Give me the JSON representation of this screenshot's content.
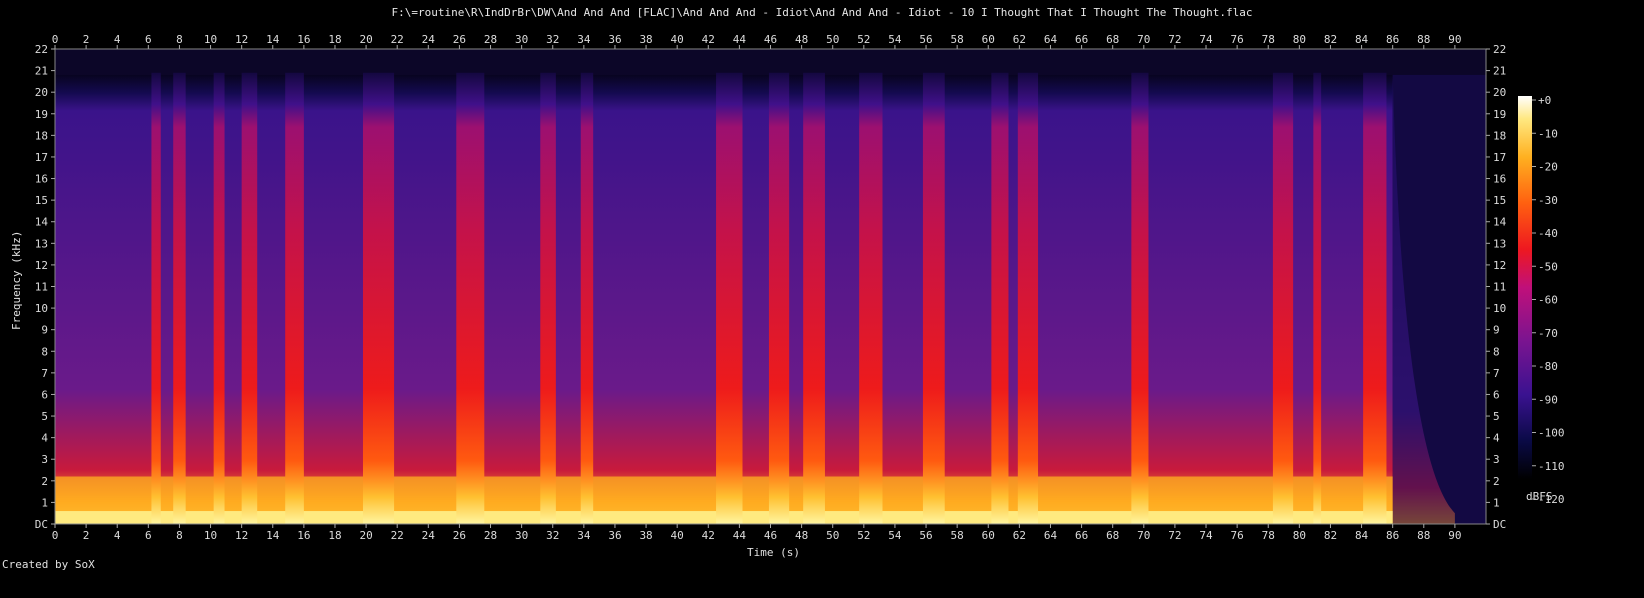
{
  "title": "F:\\=routine\\R\\IndDrBr\\DW\\And And And [FLAC]\\And And And - Idiot\\And And And - Idiot - 10 I Thought That I Thought The Thought.flac",
  "footer": "Created by SoX",
  "chart_data": {
    "type": "heatmap",
    "title": "F:\\=routine\\R\\IndDrBr\\DW\\And And And [FLAC]\\And And And - Idiot\\And And And - Idiot - 10 I Thought That I Thought The Thought.flac",
    "xlabel": "Time (s)",
    "ylabel": "Frequency (kHz)",
    "xlim": [
      0,
      92
    ],
    "ylim": [
      0,
      22
    ],
    "x_ticks": [
      "0",
      "2",
      "4",
      "6",
      "8",
      "10",
      "12",
      "14",
      "16",
      "18",
      "20",
      "22",
      "24",
      "26",
      "28",
      "30",
      "32",
      "34",
      "36",
      "38",
      "40",
      "42",
      "44",
      "46",
      "48",
      "50",
      "52",
      "54",
      "56",
      "58",
      "60",
      "62",
      "64",
      "66",
      "68",
      "70",
      "72",
      "74",
      "76",
      "78",
      "80",
      "82",
      "84",
      "86",
      "88",
      "90"
    ],
    "y_ticks": [
      "DC",
      "1",
      "2",
      "3",
      "4",
      "5",
      "6",
      "7",
      "8",
      "9",
      "10",
      "11",
      "12",
      "13",
      "14",
      "15",
      "16",
      "17",
      "18",
      "19",
      "20",
      "21",
      "22"
    ],
    "colorbar": {
      "label": "dBFS",
      "ticks": [
        "+0",
        "-10",
        "-20",
        "-30",
        "-40",
        "-50",
        "-60",
        "-70",
        "-80",
        "-90",
        "-100",
        "-110",
        "-120"
      ],
      "range": [
        -120,
        0
      ]
    },
    "signal_end_s": 86,
    "fade_out_s": [
      86,
      90
    ],
    "active_segments_s": [
      [
        6.2,
        6.8
      ],
      [
        7.6,
        8.4
      ],
      [
        10.2,
        10.9
      ],
      [
        12.0,
        13.0
      ],
      [
        14.8,
        16.0
      ],
      [
        19.8,
        21.8
      ],
      [
        25.8,
        27.6
      ],
      [
        31.2,
        32.2
      ],
      [
        33.8,
        34.6
      ],
      [
        42.5,
        44.2
      ],
      [
        45.9,
        47.2
      ],
      [
        48.1,
        49.5
      ],
      [
        51.7,
        53.2
      ],
      [
        55.8,
        57.2
      ],
      [
        60.2,
        61.3
      ],
      [
        61.9,
        63.2
      ],
      [
        69.2,
        70.3
      ],
      [
        78.3,
        79.6
      ],
      [
        80.9,
        81.4
      ],
      [
        84.1,
        85.6
      ]
    ]
  }
}
